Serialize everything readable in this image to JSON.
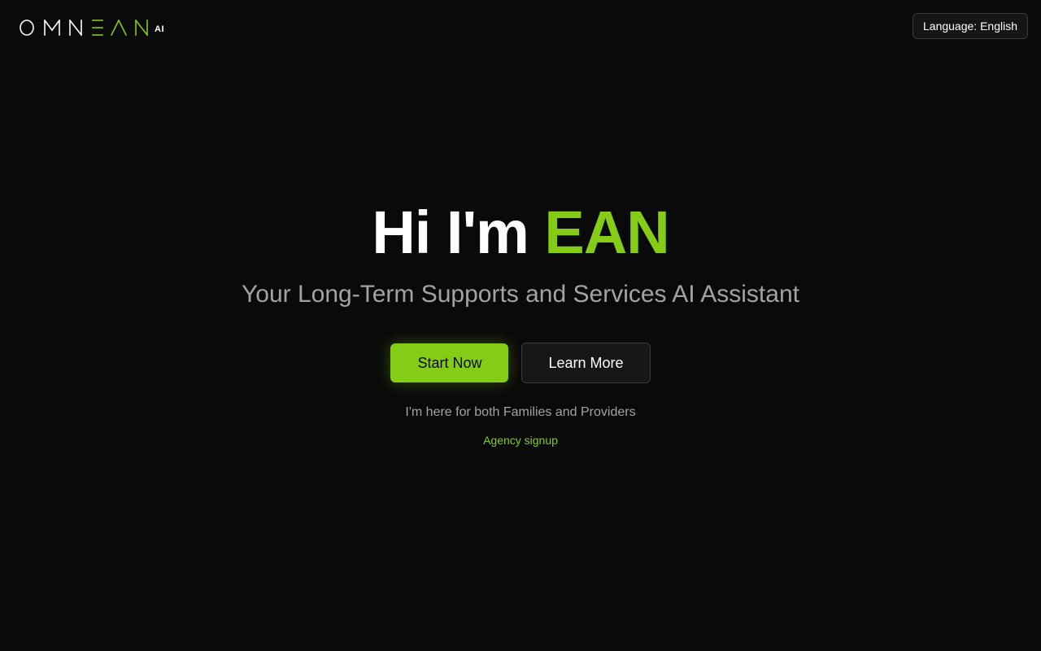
{
  "brand": {
    "logo_text": "OMNEAN",
    "logo_suffix": "AI",
    "primary_color": "#ffffff",
    "accent_color": "#84cc16"
  },
  "header": {
    "language_label": "Language: English"
  },
  "hero": {
    "greeting": "Hi I'm",
    "name": "EAN",
    "subtitle": "Your Long-Term Supports and Services AI Assistant",
    "start_button": "Start Now",
    "learn_button": "Learn More",
    "tagline": "I'm here for both Families and Providers",
    "agency_link": "Agency signup"
  },
  "colors": {
    "background": "#0a0a0a",
    "accent": "#84cc16",
    "muted_text": "#a3a3a3"
  }
}
